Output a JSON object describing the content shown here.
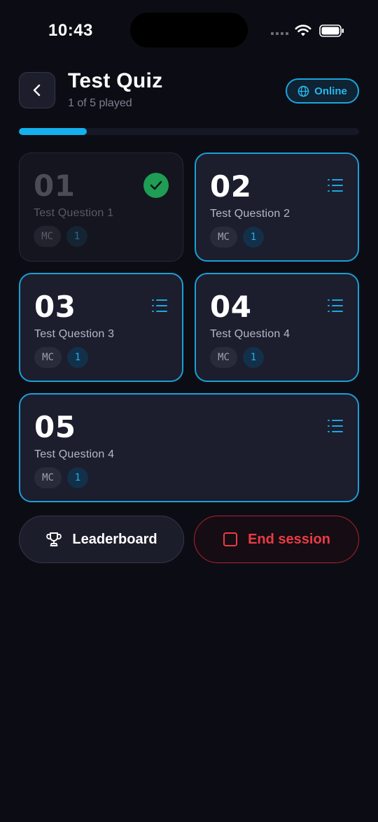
{
  "status_bar": {
    "time": "10:43"
  },
  "header": {
    "title": "Test Quiz",
    "subtitle": "1 of 5 played",
    "online_label": "Online"
  },
  "progress": {
    "played": 1,
    "total": 5,
    "fraction": 0.2
  },
  "questions": [
    {
      "number": "01",
      "name": "Test Question 1",
      "type": "MC",
      "count": "1",
      "played": true
    },
    {
      "number": "02",
      "name": "Test Question 2",
      "type": "MC",
      "count": "1",
      "played": false
    },
    {
      "number": "03",
      "name": "Test Question 3",
      "type": "MC",
      "count": "1",
      "played": false
    },
    {
      "number": "04",
      "name": "Test Question 4",
      "type": "MC",
      "count": "1",
      "played": false
    },
    {
      "number": "05",
      "name": "Test Question 4",
      "type": "MC",
      "count": "1",
      "played": false
    }
  ],
  "actions": {
    "leaderboard_label": "Leaderboard",
    "end_session_label": "End session"
  },
  "icons": {
    "back": "chevron-left-icon",
    "online": "globe-icon",
    "played": "check-circle-icon",
    "question": "list-icon",
    "leaderboard": "trophy-icon",
    "end_session": "stop-square-icon"
  },
  "colors": {
    "background": "#0c0d14",
    "accent": "#14b1ee",
    "success": "#1f9d55",
    "danger": "#ec3b45"
  }
}
